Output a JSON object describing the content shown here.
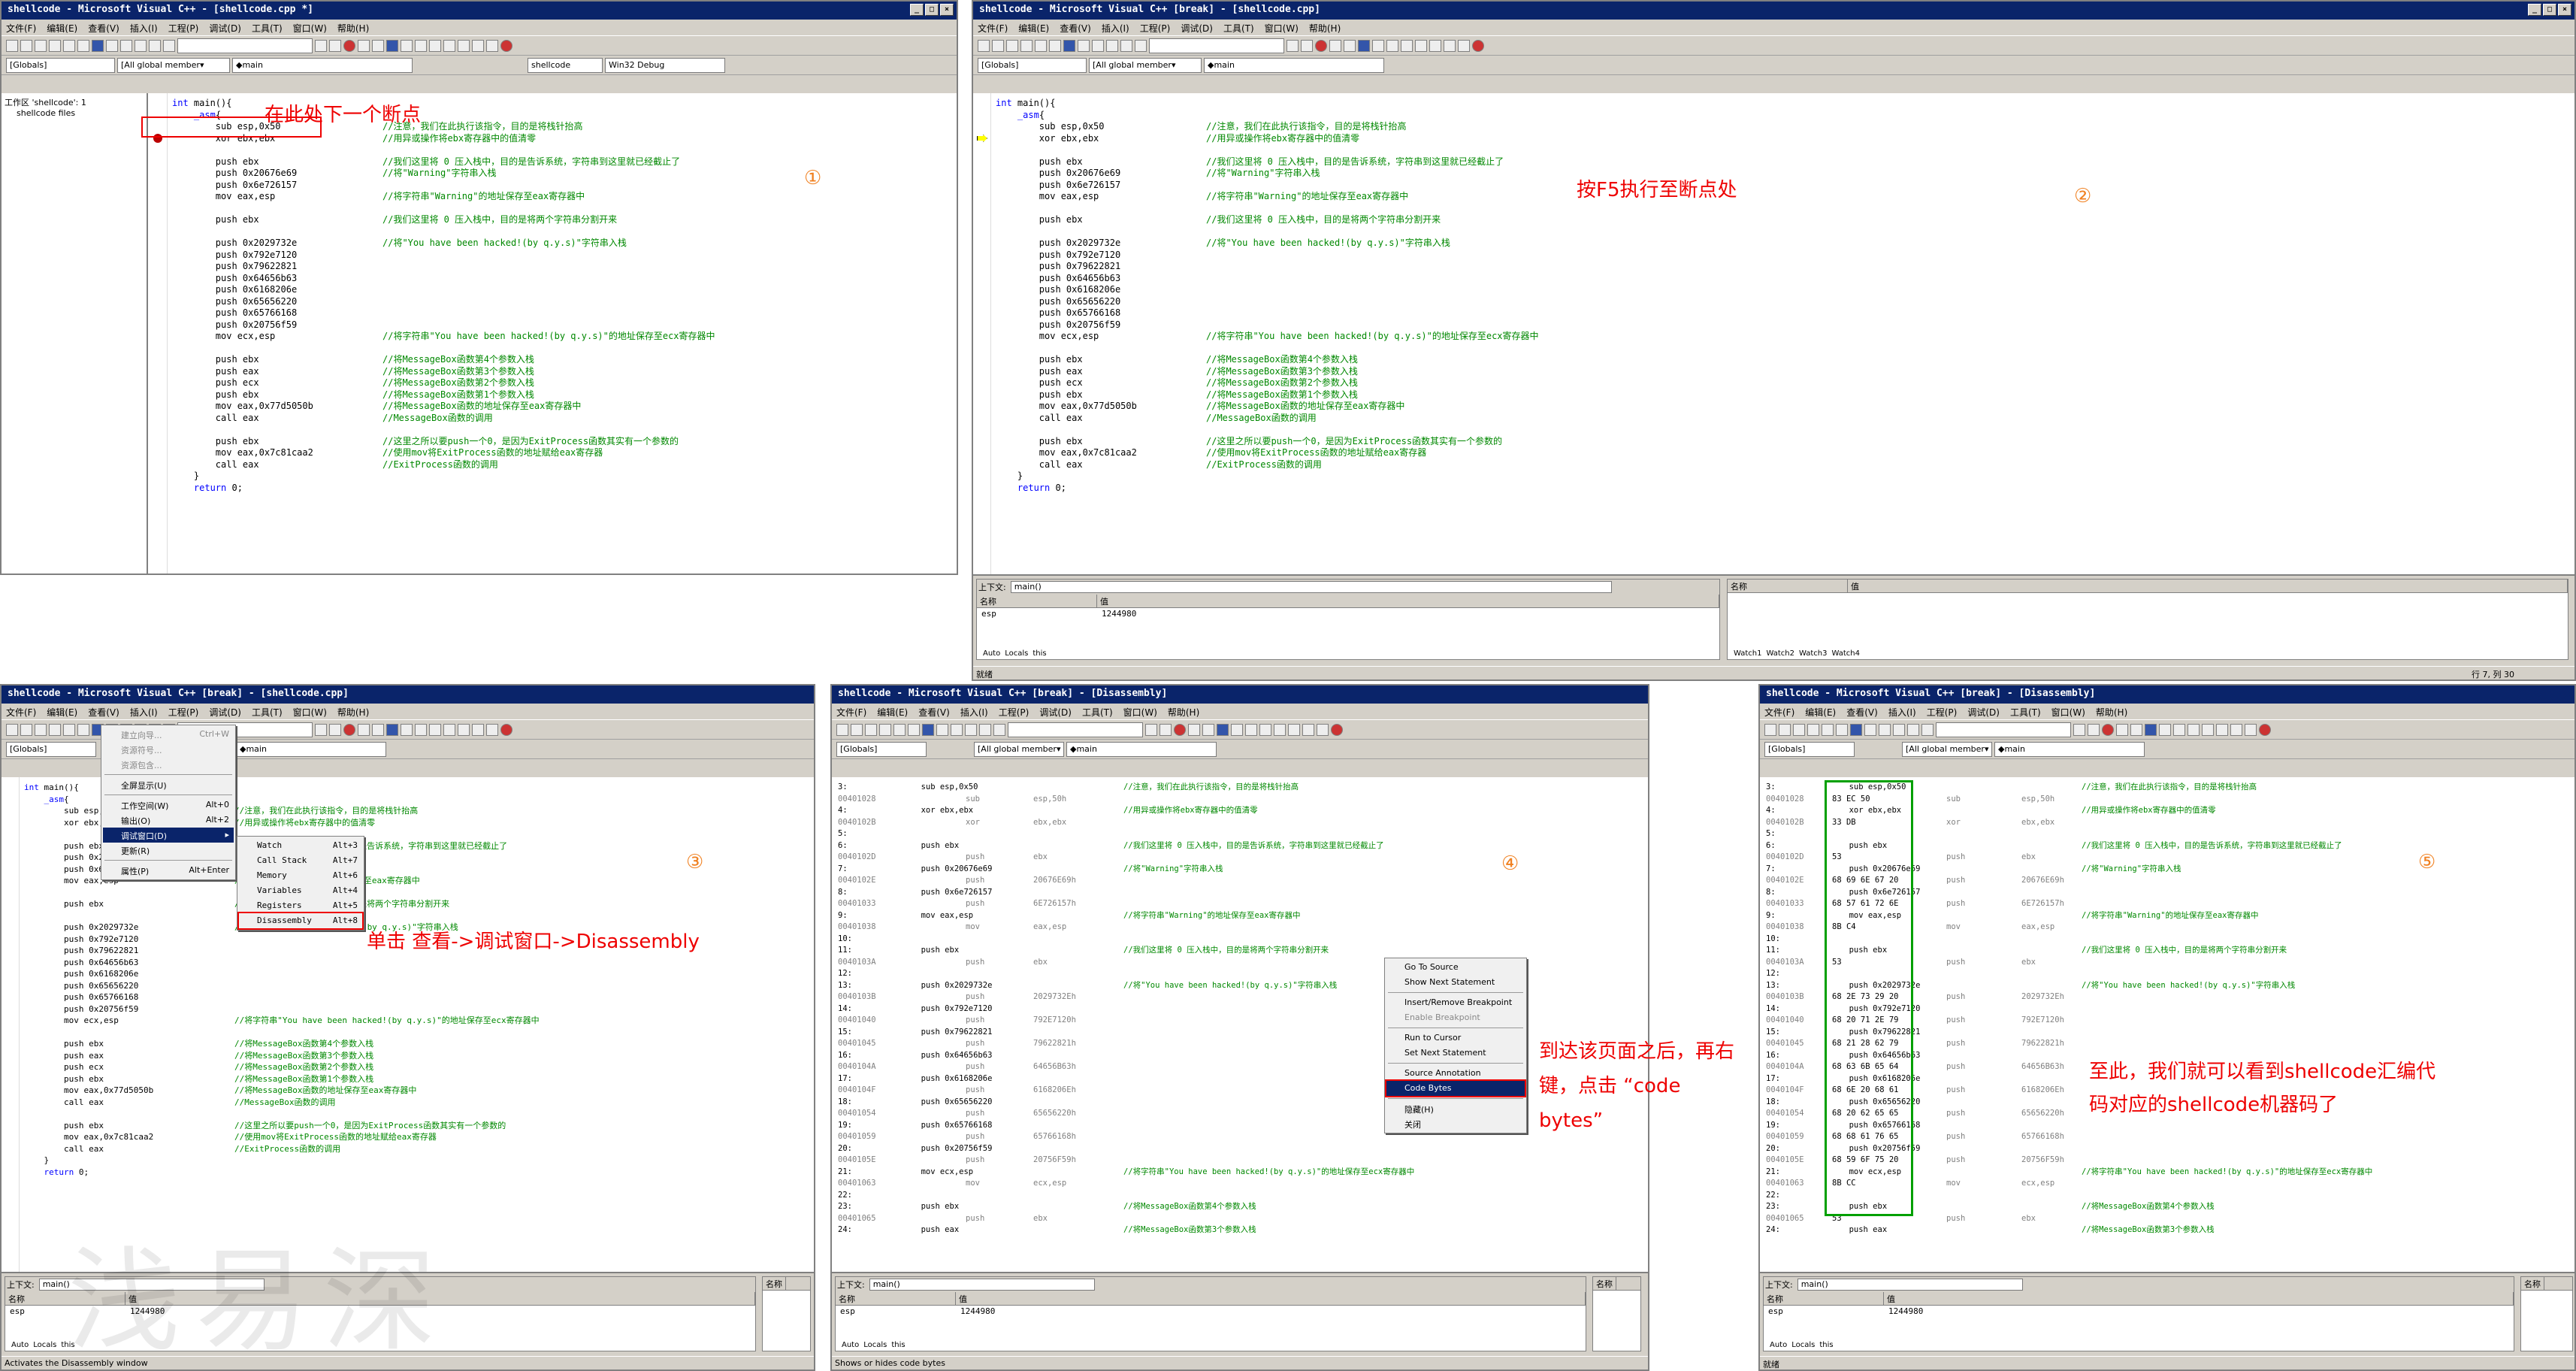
{
  "screens": [
    {
      "title": "shellcode - Microsoft Visual C++ - [shellcode.cpp *]"
    },
    {
      "title": "shellcode - Microsoft Visual C++ [break] - [shellcode.cpp]"
    },
    {
      "title": "shellcode - Microsoft Visual C++ [break] - [shellcode.cpp]"
    },
    {
      "title": "shellcode - Microsoft Visual C++ [break] - [Disassembly]"
    },
    {
      "title": "shellcode - Microsoft Visual C++ [break] - [Disassembly]"
    }
  ],
  "menu": [
    "文件(F)",
    "编辑(E)",
    "查看(V)",
    "插入(I)",
    "工程(P)",
    "调试(D)",
    "工具(T)",
    "窗口(W)",
    "帮助(H)"
  ],
  "combos": {
    "globals": "[Globals]",
    "members": "[All global member▾",
    "func": "◆main",
    "project": "shellcode",
    "config": "Win32 Debug"
  },
  "workspace": {
    "root": "工作区 'shellcode': 1",
    "child": "shellcode files"
  },
  "code": [
    [
      "int main(){",
      ""
    ],
    [
      "    _asm{",
      ""
    ],
    [
      "        sub esp,0x50",
      "//注意，我们在此执行该指令，目的是将栈针抬高"
    ],
    [
      "        xor ebx,ebx",
      "//用异或操作将ebx寄存器中的值清零"
    ],
    [
      "",
      ""
    ],
    [
      "        push ebx",
      "//我们这里将 0 压入栈中，目的是告诉系统，字符串到这里就已经截止了"
    ],
    [
      "        push 0x20676e69",
      "//将\"Warning\"字符串入栈"
    ],
    [
      "        push 0x6e726157",
      ""
    ],
    [
      "        mov eax,esp",
      "//将字符串\"Warning\"的地址保存至eax寄存器中"
    ],
    [
      "",
      ""
    ],
    [
      "        push ebx",
      "//我们这里将 0 压入栈中，目的是将两个字符串分割开来"
    ],
    [
      "",
      ""
    ],
    [
      "        push 0x2029732e",
      "//将\"You have been hacked!(by q.y.s)\"字符串入栈"
    ],
    [
      "        push 0x792e7120",
      ""
    ],
    [
      "        push 0x79622821",
      ""
    ],
    [
      "        push 0x64656b63",
      ""
    ],
    [
      "        push 0x6168206e",
      ""
    ],
    [
      "        push 0x65656220",
      ""
    ],
    [
      "        push 0x65766168",
      ""
    ],
    [
      "        push 0x20756f59",
      ""
    ],
    [
      "        mov ecx,esp",
      "//将字符串\"You have been hacked!(by q.y.s)\"的地址保存至ecx寄存器中"
    ],
    [
      "",
      ""
    ],
    [
      "        push ebx",
      "//将MessageBox函数第4个参数入栈"
    ],
    [
      "        push eax",
      "//将MessageBox函数第3个参数入栈"
    ],
    [
      "        push ecx",
      "//将MessageBox函数第2个参数入栈"
    ],
    [
      "        push ebx",
      "//将MessageBox函数第1个参数入栈"
    ],
    [
      "        mov eax,0x77d5050b",
      "//将MessageBox函数的地址保存至eax寄存器中"
    ],
    [
      "        call eax",
      "//MessageBox函数的调用"
    ],
    [
      "",
      ""
    ],
    [
      "        push ebx",
      "//这里之所以要push一个0，是因为ExitProcess函数其实有一个参数的"
    ],
    [
      "        mov eax,0x7c81caa2",
      "//使用mov将ExitProcess函数的地址赋给eax寄存器"
    ],
    [
      "        call eax",
      "//ExitProcess函数的调用"
    ],
    [
      "    }",
      ""
    ],
    [
      "    return 0;",
      ""
    ]
  ],
  "disasm": [
    [
      "3:",
      "        sub esp,0x50",
      "//注意，我们在此执行该指令，目的是将栈针抬高"
    ],
    [
      "00401028",
      "83 EC 50",
      "sub   esp,50h"
    ],
    [
      "4:",
      "        xor ebx,ebx",
      "//用异或操作将ebx寄存器中的值清零"
    ],
    [
      "0040102B",
      "33 DB",
      "xor   ebx,ebx"
    ],
    [
      "5:",
      "",
      ""
    ],
    [
      "6:",
      "        push ebx",
      "//我们这里将 0 压入栈中，目的是告诉系统，字符串到这里就已经截止了"
    ],
    [
      "0040102D",
      "53",
      "push  ebx"
    ],
    [
      "7:",
      "        push 0x20676e69",
      "//将\"Warning\"字符串入栈"
    ],
    [
      "0040102E",
      "68 69 6E 67 20",
      "push  20676E69h"
    ],
    [
      "8:",
      "        push 0x6e726157",
      ""
    ],
    [
      "00401033",
      "68 57 61 72 6E",
      "push  6E726157h"
    ],
    [
      "9:",
      "        mov eax,esp",
      "//将字符串\"Warning\"的地址保存至eax寄存器中"
    ],
    [
      "00401038",
      "8B C4",
      "mov   eax,esp"
    ],
    [
      "10:",
      "",
      ""
    ],
    [
      "11:",
      "        push ebx",
      "//我们这里将 0 压入栈中，目的是将两个字符串分割开来"
    ],
    [
      "0040103A",
      "53",
      "push  ebx"
    ],
    [
      "12:",
      "",
      ""
    ],
    [
      "13:",
      "        push 0x2029732e",
      "//将\"You have been hacked!(by q.y.s)\"字符串入栈"
    ],
    [
      "0040103B",
      "68 2E 73 29 20",
      "push  2029732Eh"
    ],
    [
      "14:",
      "        push 0x792e7120",
      ""
    ],
    [
      "00401040",
      "68 20 71 2E 79",
      "push  792E7120h"
    ],
    [
      "15:",
      "        push 0x79622821",
      ""
    ],
    [
      "00401045",
      "68 21 28 62 79",
      "push  79622821h"
    ],
    [
      "16:",
      "        push 0x64656b63",
      ""
    ],
    [
      "0040104A",
      "68 63 6B 65 64",
      "push  64656B63h"
    ],
    [
      "17:",
      "        push 0x6168206e",
      ""
    ],
    [
      "0040104F",
      "68 6E 20 68 61",
      "push  6168206Eh"
    ],
    [
      "18:",
      "        push 0x65656220",
      ""
    ],
    [
      "00401054",
      "68 20 62 65 65",
      "push  65656220h"
    ],
    [
      "19:",
      "        push 0x65766168",
      ""
    ],
    [
      "00401059",
      "68 68 61 76 65",
      "push  65766168h"
    ],
    [
      "20:",
      "        push 0x20756f59",
      ""
    ],
    [
      "0040105E",
      "68 59 6F 75 20",
      "push  20756F59h"
    ],
    [
      "21:",
      "        mov ecx,esp",
      "//将字符串\"You have been hacked!(by q.y.s)\"的地址保存至ecx寄存器中"
    ],
    [
      "00401063",
      "8B CC",
      "mov   ecx,esp"
    ],
    [
      "22:",
      "",
      ""
    ],
    [
      "23:",
      "        push ebx",
      "//将MessageBox函数第4个参数入栈"
    ],
    [
      "00401065",
      "53",
      "push  ebx"
    ],
    [
      "24:",
      "        push eax",
      "//将MessageBox函数第3个参数入栈"
    ]
  ],
  "debug": {
    "context_label": "上下文:",
    "context_value": "main()",
    "col_name": "名称",
    "col_value": "值",
    "var_name": "esp",
    "var_value": "1244980",
    "tabs_left": [
      "Auto",
      "Locals",
      "this"
    ],
    "tabs_right": [
      "Watch1",
      "Watch2",
      "Watch3",
      "Watch4"
    ]
  },
  "status": {
    "s2": "就绪",
    "s2_pos": "行 7, 列 30",
    "s3": "Activates the Disassembly window",
    "s4": "Shows or hides code bytes",
    "s5": "就绪"
  },
  "view_menu": [
    {
      "label": "建立向导...",
      "shortcut": "Ctrl+W"
    },
    {
      "label": "资源符号...",
      "shortcut": ""
    },
    {
      "label": "资源包含...",
      "shortcut": ""
    },
    {
      "label": "全屏显示(U)",
      "shortcut": ""
    },
    {
      "label": "工作空间(W)",
      "shortcut": "Alt+0"
    },
    {
      "label": "输出(O)",
      "shortcut": "Alt+2"
    },
    {
      "label": "调试窗口(D)",
      "shortcut": "▸"
    },
    {
      "label": "更新(R)",
      "shortcut": ""
    },
    {
      "label": "属性(P)",
      "shortcut": "Alt+Enter"
    }
  ],
  "debug_submenu": [
    {
      "label": "Watch",
      "shortcut": "Alt+3"
    },
    {
      "label": "Call Stack",
      "shortcut": "Alt+7"
    },
    {
      "label": "Memory",
      "shortcut": "Alt+6"
    },
    {
      "label": "Variables",
      "shortcut": "Alt+4"
    },
    {
      "label": "Registers",
      "shortcut": "Alt+5"
    },
    {
      "label": "Disassembly",
      "shortcut": "Alt+8"
    }
  ],
  "ctx_menu": [
    "Go To Source",
    "Show Next Statement",
    "Insert/Remove Breakpoint",
    "Enable Breakpoint",
    "Run to Cursor",
    "Set Next Statement",
    "Source Annotation",
    "Code Bytes",
    "隐藏(H)",
    "关闭"
  ],
  "annotations": {
    "a1": "在此处下一个断点",
    "a2": "按F5执行至断点处",
    "a3": "单击 查看->调试窗口->Disassembly",
    "a4": "到达该页面之后，再右键，点击 “code bytes”",
    "a5": "至此，我们就可以看到shellcode汇编代码对应的shellcode机器码了",
    "n1": "①",
    "n2": "②",
    "n3": "③",
    "n4": "④",
    "n5": "⑤"
  },
  "watermark": "浅易深"
}
